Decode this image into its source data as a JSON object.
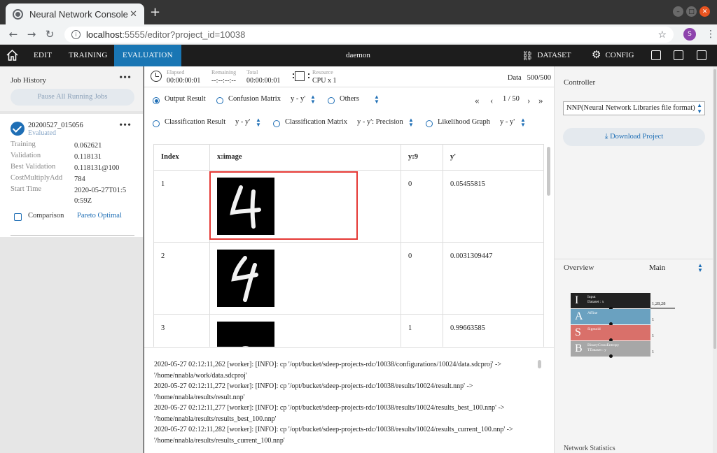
{
  "browser": {
    "tab_title": "Neural Network Console",
    "url_host": "localhost",
    "url_path": ":5555/editor?project_id=10038",
    "profile_initial": "S"
  },
  "appbar": {
    "nav": [
      "EDIT",
      "TRAINING",
      "EVALUATION"
    ],
    "active": "EVALUATION",
    "project_name": "daemon",
    "dataset_label": "DATASET",
    "config_label": "CONFIG"
  },
  "job_history": {
    "title": "Job History",
    "pause_label": "Pause All Running Jobs",
    "job": {
      "name": "20200527_015056",
      "status": "Evaluated",
      "stats": [
        {
          "label": "Training",
          "value": "0.062621"
        },
        {
          "label": "Validation",
          "value": "0.118131"
        },
        {
          "label": "Best Validation",
          "value": "0.118131@100"
        },
        {
          "label": "CostMultiplyAdd",
          "value": "784"
        },
        {
          "label": "Start Time",
          "value": "2020-05-27T01:5 0:59Z"
        }
      ],
      "comparison_label": "Comparison",
      "pareto_label": "Pareto Optimal"
    }
  },
  "status": {
    "elapsed_label": "Elapsed",
    "elapsed": "00:00:00:01",
    "remaining_label": "Remaining",
    "remaining": "--:--:--:--",
    "total_label": "Total",
    "total": "00:00:00:01",
    "resource_label": "Resource",
    "resource": "CPU x 1",
    "data_label": "Data   500/500"
  },
  "options": {
    "output_result": "Output Result",
    "confusion_matrix": "Confusion Matrix",
    "confusion_sel": "y - y'",
    "others": "Others",
    "page": "1 / 50",
    "classification_result": "Classification Result",
    "classification_result_sel": "y - y'",
    "classification_matrix": "Classification Matrix",
    "classification_matrix_sel": "y - y': Precision",
    "likelihood_graph": "Likelihood Graph",
    "likelihood_sel": "y - y'"
  },
  "table": {
    "headers": [
      "Index",
      "x:image",
      "y:9",
      "y'"
    ],
    "rows": [
      {
        "index": "1",
        "y": "0",
        "yp": "0.05455815"
      },
      {
        "index": "2",
        "y": "0",
        "yp": "0.0031309447"
      },
      {
        "index": "3",
        "y": "1",
        "yp": "0.99663585"
      }
    ]
  },
  "log_lines": [
    "2020-05-27 02:12:11,262 [worker]: [INFO]: cp '/opt/bucket/sdeep-projects-rdc/10038/configurations/10024/data.sdcproj' ->",
    "'/home/nnabla/work/data.sdcproj'",
    "2020-05-27 02:12:11,272 [worker]: [INFO]: cp '/opt/bucket/sdeep-projects-rdc/10038/results/10024/result.nnp' ->",
    "'/home/nnabla/results/result.nnp'",
    "2020-05-27 02:12:11,277 [worker]: [INFO]: cp '/opt/bucket/sdeep-projects-rdc/10038/results/10024/results_best_100.nnp' ->",
    "'/home/nnabla/results/results_best_100.nnp'",
    "2020-05-27 02:12:11,282 [worker]: [INFO]: cp '/opt/bucket/sdeep-projects-rdc/10038/results/10024/results_current_100.nnp' ->",
    "'/home/nnabla/results/results_current_100.nnp'"
  ],
  "controller": {
    "title": "Controller",
    "format": "NNP(Neural Network Libraries file format)",
    "download_label": "Download Project",
    "overview_title": "Overview",
    "overview_sel": "Main",
    "network_stats": "Network Statistics"
  },
  "network": {
    "layers": [
      {
        "letter": "I",
        "name": "Input",
        "sub": "Dataset : x",
        "color": "#222222",
        "dim": "1,28,28"
      },
      {
        "letter": "A",
        "name": "Affine",
        "sub": "",
        "color": "#6aa1c0",
        "dim": "1"
      },
      {
        "letter": "S",
        "name": "Sigmoid",
        "sub": "",
        "color": "#d9706a",
        "dim": "1"
      },
      {
        "letter": "B",
        "name": "BinaryCrossEntropy",
        "sub": "TDataset : y",
        "color": "#a7a7a7",
        "dim": "1"
      }
    ]
  }
}
